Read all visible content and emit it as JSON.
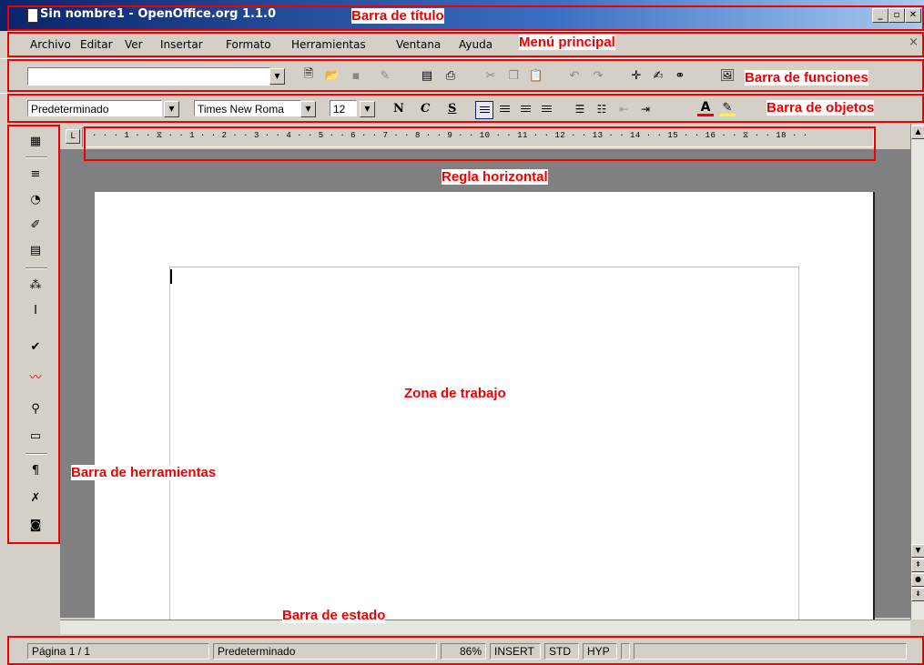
{
  "window": {
    "title": "Sin nombre1 - OpenOffice.org 1.1.0",
    "controls": {
      "minimize": "_",
      "maximize": "▫",
      "close": "✕"
    }
  },
  "menu": {
    "items": [
      "Archivo",
      "Editar",
      "Ver",
      "Insertar",
      "Formato",
      "Herramientas",
      "Ventana",
      "Ayuda"
    ],
    "close": "×"
  },
  "function_bar": {
    "url_value": "",
    "icons": [
      "edit-file-icon",
      "open-icon",
      "save-icon",
      "edit-mode-icon",
      "export-pdf-icon",
      "print-icon",
      "cut-icon",
      "copy-icon",
      "paste-icon",
      "undo-icon",
      "redo-icon",
      "navigator-icon",
      "stylist-icon",
      "hyperlink-icon",
      "gallery-icon"
    ]
  },
  "object_bar": {
    "style": "Predeterminado",
    "font": "Times New Roma",
    "size": "12",
    "bold": "N",
    "italic": "C",
    "underline": "S"
  },
  "ruler": {
    "text": "· · · 1 · · ⧖ · · 1 · · 2 · · 3 · · 4 · · 5 · · 6 · · 7 · · 8 · · 9 · · 10 · · 11 · · 12 · · 13 · · 14 · · 15 · · 16 · · ⧖ · · 18 · ·",
    "corner": "L"
  },
  "statusbar": {
    "page": "Página 1 / 1",
    "style": "Predeterminado",
    "zoom": "86%",
    "mode": "INSERT",
    "sel": "STD",
    "hyp": "HYP"
  },
  "annotations": {
    "title_bar": "Barra de título",
    "main_menu": "Menú principal",
    "functions_bar": "Barra de funciones",
    "objects_bar": "Barra de objetos",
    "ruler": "Regla horizontal",
    "work_area": "Zona de trabajo",
    "tools_bar": "Barra de herramientas",
    "status_bar": "Barra de estado"
  },
  "colors": {
    "annotation": "#ee0000",
    "titlebar": "#0a246a"
  }
}
